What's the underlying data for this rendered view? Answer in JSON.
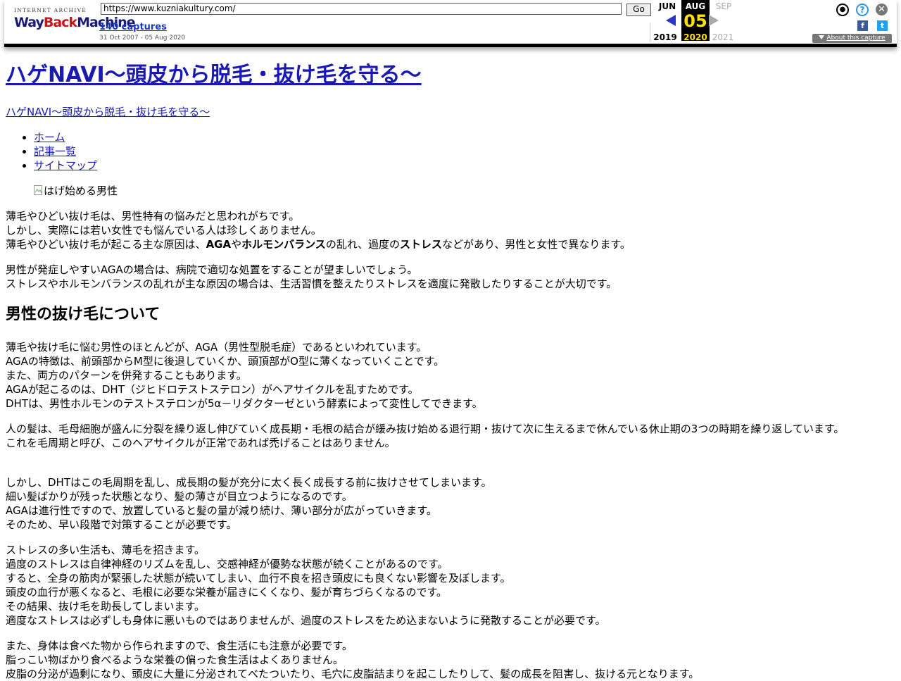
{
  "wayback": {
    "logo_top": "INTERNET ARCHIVE",
    "logo_w1": "Way",
    "logo_w2": "Back",
    "logo_w3": "Machine",
    "url": "https://www.kuzniakultury.com/",
    "go_label": "Go",
    "captures_label": "140 captures",
    "range": "31 Oct 2007 - 05 Aug 2020",
    "month_prev": "JUN",
    "month_cur": "AUG",
    "month_next": "SEP",
    "day_cur": "05",
    "year_prev": "2019",
    "year_cur": "2020",
    "year_next": "2021",
    "about_label": "About this capture",
    "colors": {
      "arrow_active": "#2b35c8",
      "highlight": "#ffe100",
      "help": "#2b96e4"
    }
  },
  "page": {
    "title": "ハゲNAVI～頭皮から脱毛・抜け毛を守る～",
    "subtitle": "ハゲNAVI～頭皮から脱毛・抜け毛を守る～",
    "nav": [
      {
        "label": "ホーム"
      },
      {
        "label": "記事一覧"
      },
      {
        "label": "サイトマップ"
      }
    ],
    "hero_alt": "はげ始める男性",
    "p1": {
      "l1": "薄毛やひどい抜け毛は、男性特有の悩みだと思われがちです。",
      "l2": "しかし、実際には若い女性でも悩んでいる人は珍しくありません。",
      "l3a": "薄毛やひどい抜け毛が起こる主な原因は、",
      "l3b": "AGA",
      "l3c": "や",
      "l3d": "ホルモンバランス",
      "l3e": "の乱れ、過度の",
      "l3f": "ストレス",
      "l3g": "などがあり、男性と女性で異なります。"
    },
    "p2": {
      "l1": "男性が発症しやすいAGAの場合は、病院で適切な処置をすることが望ましいでしょう。",
      "l2": "ストレスやホルモンバランスの乱れが主な原因の場合は、生活習慣を整えたりストレスを適度に発散したりすることが大切です。"
    },
    "h2": "男性の抜け毛について",
    "p3": [
      "薄毛や抜け毛に悩む男性のほとんどが、AGA（男性型脱毛症）であるといわれています。",
      "AGAの特徴は、前頭部からM型に後退していくか、頭頂部がO型に薄くなっていくことです。",
      "また、両方のパターンを併発することもあります。",
      "AGAが起こるのは、DHT（ジヒドロテストステロン）がヘアサイクルを乱すためです。",
      "DHTは、男性ホルモンのテストステロンが5α－リダクターゼという酵素によって変性してできます。"
    ],
    "p4": [
      "人の髪は、毛母細胞が盛んに分裂を繰り返し伸びていく成長期・毛根の結合が緩み抜け始める退行期・抜けて次に生えるまで休んでいる休止期の3つの時期を繰り返しています。",
      "これを毛周期と呼び、このヘアサイクルが正常であれば禿げることはありません。"
    ],
    "p5": [
      "しかし、DHTはこの毛周期を乱し、成長期の髪が充分に太く長く成長する前に抜けさせてしまいます。",
      "細い髪ばかりが残った状態となり、髪の薄さが目立つようになるのです。",
      "AGAは進行性ですので、放置していると髪の量が減り続け、薄い部分が広がっていきます。",
      "そのため、早い段階で対策することが必要です。"
    ],
    "p6": [
      "ストレスの多い生活も、薄毛を招きます。",
      "過度のストレスは自律神経のリズムを乱し、交感神経が優勢な状態が続くことがあるのです。",
      "すると、全身の筋肉が緊張した状態が続いてしまい、血行不良を招き頭皮にも良くない影響を及ぼします。",
      "頭皮の血行が悪くなると、毛根に必要な栄養が届きにくくなり、髪が育ちづらくなるのです。",
      "その結果、抜け毛を助長してしまいます。",
      "適度なストレスは必ずしも身体に悪いものではありませんが、過度のストレスをため込まないように発散することが必要です。"
    ],
    "p7": [
      "また、身体は食べた物から作られますので、食生活にも注意が必要です。",
      "脂っこい物ばかり食べるような栄養の偏った食生活はよくありません。",
      "皮脂の分泌が過剰になり、頭皮に大量に分泌されてべたついたり、毛穴に皮脂詰まりを起こしたりして、髪の成長を阻害し、抜ける元となります。"
    ]
  }
}
